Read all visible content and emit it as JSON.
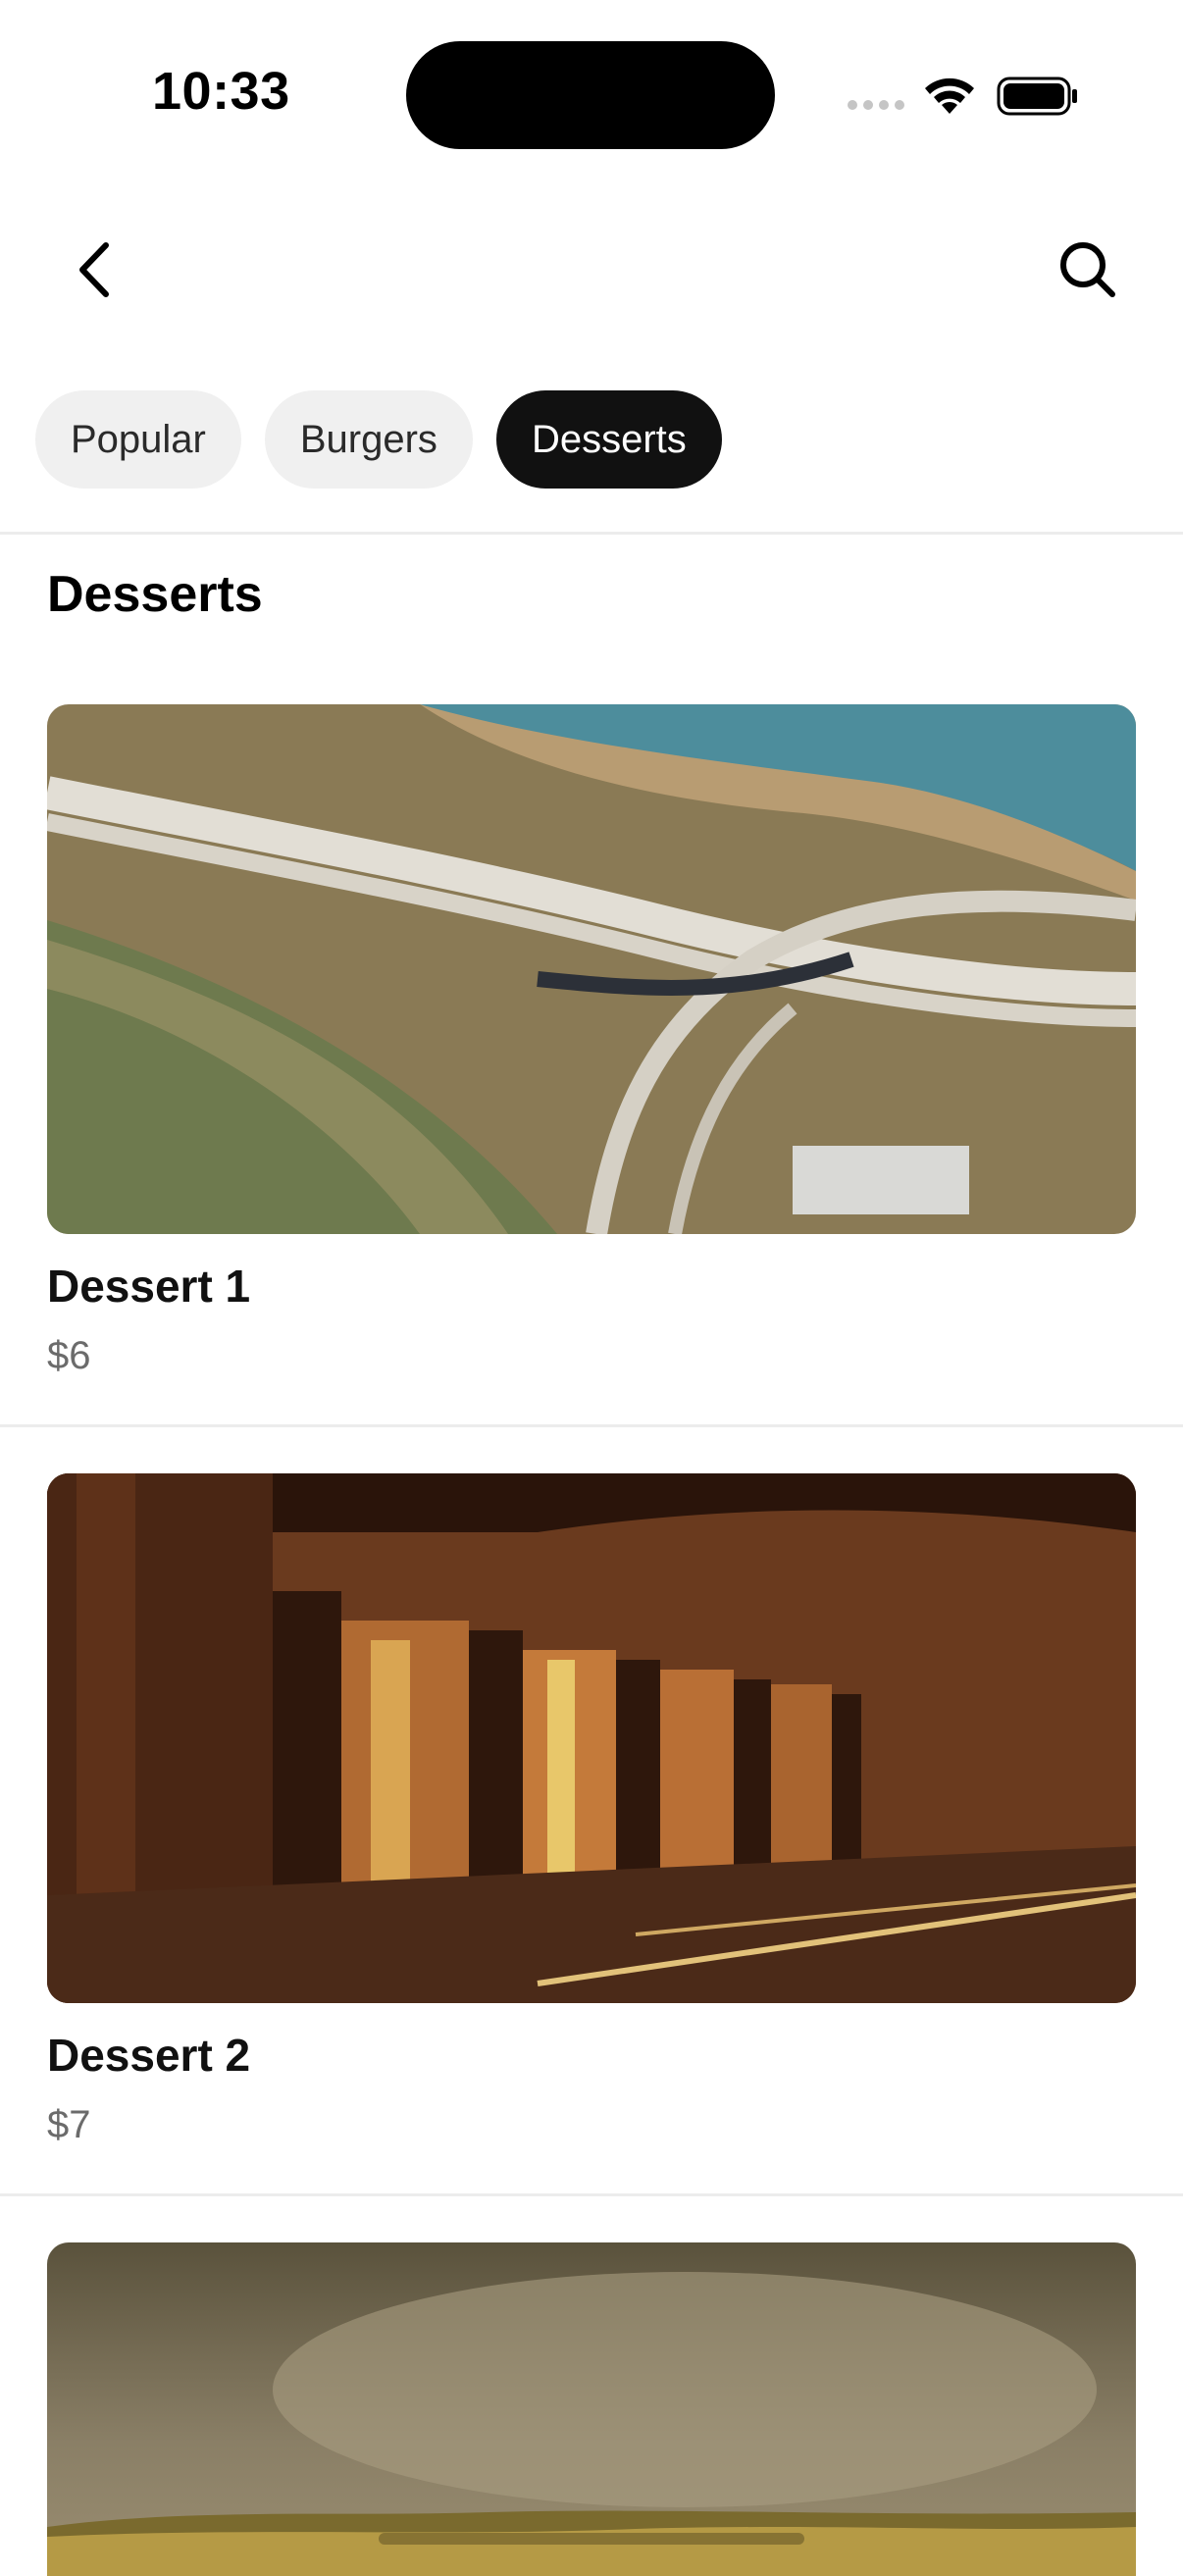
{
  "status": {
    "time": "10:33"
  },
  "header": {
    "back_icon": "chevron-left-icon",
    "search_icon": "search-icon"
  },
  "tabs": [
    {
      "label": "Popular",
      "active": false
    },
    {
      "label": "Burgers",
      "active": false
    },
    {
      "label": "Desserts",
      "active": true
    }
  ],
  "section": {
    "title": "Desserts"
  },
  "items": [
    {
      "name": "Dessert 1",
      "price": "$6",
      "image": "aerial-highway-interchange"
    },
    {
      "name": "Dessert 2",
      "price": "$7",
      "image": "arched-cloister-hall"
    },
    {
      "image": "hazy-sunlit-hillside"
    }
  ],
  "colors": {
    "accent": "#111111",
    "chip_bg": "#f0f0f0",
    "price": "#6b6b6b"
  }
}
